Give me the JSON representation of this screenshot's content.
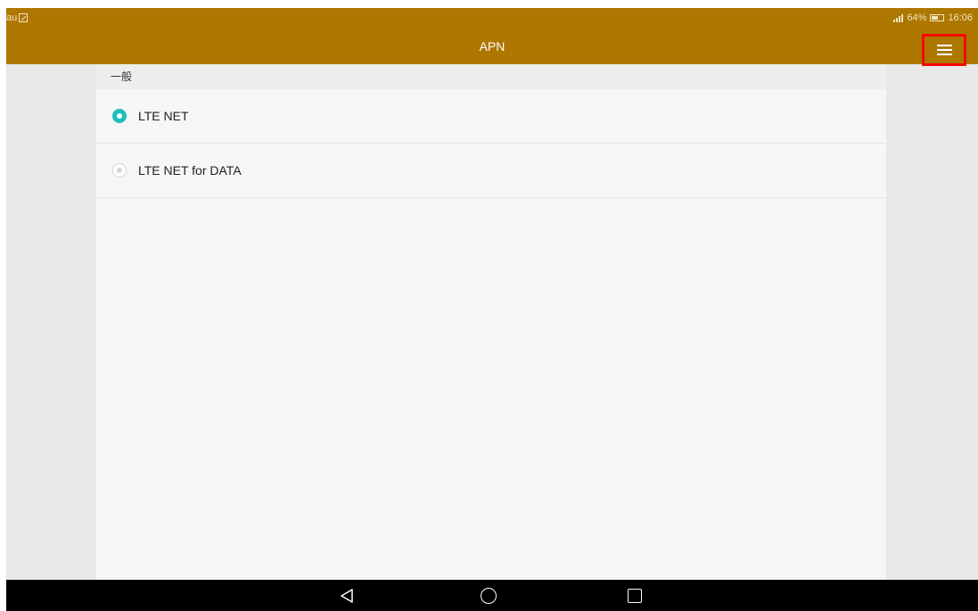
{
  "status_bar": {
    "carrier": "au",
    "battery_percent": "64%",
    "time": "16:06",
    "battery_level": 0.64,
    "icons": [
      "sim-icon",
      "signal-icon",
      "battery-icon"
    ]
  },
  "app_bar": {
    "title": "APN",
    "menu_icon": "hamburger-menu-icon",
    "highlight_color": "#ff0000"
  },
  "section": {
    "header": "一般"
  },
  "apn_list": [
    {
      "label": "LTE NET",
      "selected": true
    },
    {
      "label": "LTE NET for DATA",
      "selected": false
    }
  ],
  "nav_bar": {
    "icons": [
      "back-icon",
      "home-icon",
      "recent-apps-icon"
    ]
  },
  "colors": {
    "accent": "#ad7700",
    "radio_selected": "#1ebdbd",
    "background": "#e8e8e8",
    "panel": "#f6f6f6"
  }
}
